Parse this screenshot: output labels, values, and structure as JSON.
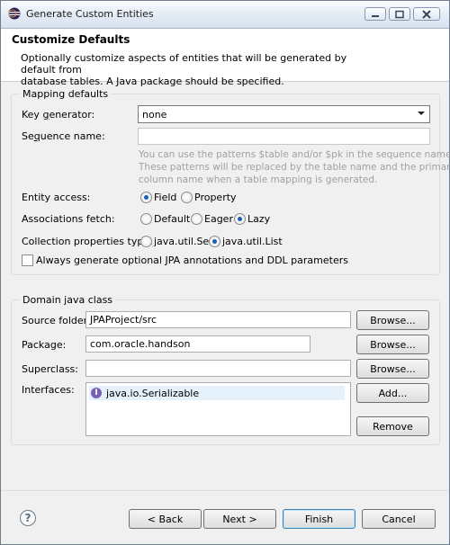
{
  "window": {
    "title": "Generate Custom Entities",
    "icons": [
      "eclipse-app-icon",
      "minimize-icon",
      "maximize-icon",
      "close-icon"
    ],
    "accent": "#1a5fb4"
  },
  "header": {
    "title": "Customize Defaults",
    "description_line1": "Optionally customize aspects of entities that will be generated by default from",
    "description_line2": "database tables. A Java package should be specified."
  },
  "mapping": {
    "legend": "Mapping defaults",
    "key_generator": {
      "label_pre": "Key ",
      "label_u": "g",
      "label_post": "enerator:",
      "value": "none"
    },
    "sequence_name": {
      "label_pre": "Se",
      "label_u": "q",
      "label_post": "uence name:",
      "value": ""
    },
    "help_lines": [
      "You can use the patterns $table and/or $pk in the sequence name.",
      "These patterns will be replaced by the table name and the primary ke",
      "column name when a table mapping is generated."
    ],
    "entity_access": {
      "label": "Entity access:",
      "options": [
        "Field",
        "Property"
      ],
      "selected": "Field"
    },
    "associations_fetch": {
      "label": "Associations fetch:",
      "options": [
        "Default",
        "Eager",
        "Lazy"
      ],
      "selected": "Lazy"
    },
    "collection_type": {
      "label": "Collection properties type:",
      "options": [
        "java.util.Set",
        "java.util.List"
      ],
      "selected": "java.util.List"
    },
    "always_generate": {
      "label": "Always generate optional JPA annotations and DDL parameters",
      "checked": false
    }
  },
  "domain": {
    "legend": "Domain java class",
    "source_folder": {
      "label": "Source folder:",
      "value": "JPAProject/src",
      "button": "Browse..."
    },
    "package": {
      "label": "Package:",
      "value": "com.oracle.handson",
      "button": "Browse..."
    },
    "superclass": {
      "label": "Superclass:",
      "value": "",
      "button": "Browse..."
    },
    "interfaces": {
      "label": "Interfaces:",
      "items": [
        "java.io.Serializable"
      ],
      "add_button": "Add...",
      "remove_button": "Remove"
    }
  },
  "footer": {
    "back": "< Back",
    "next": "Next >",
    "finish": "Finish",
    "cancel": "Cancel"
  }
}
